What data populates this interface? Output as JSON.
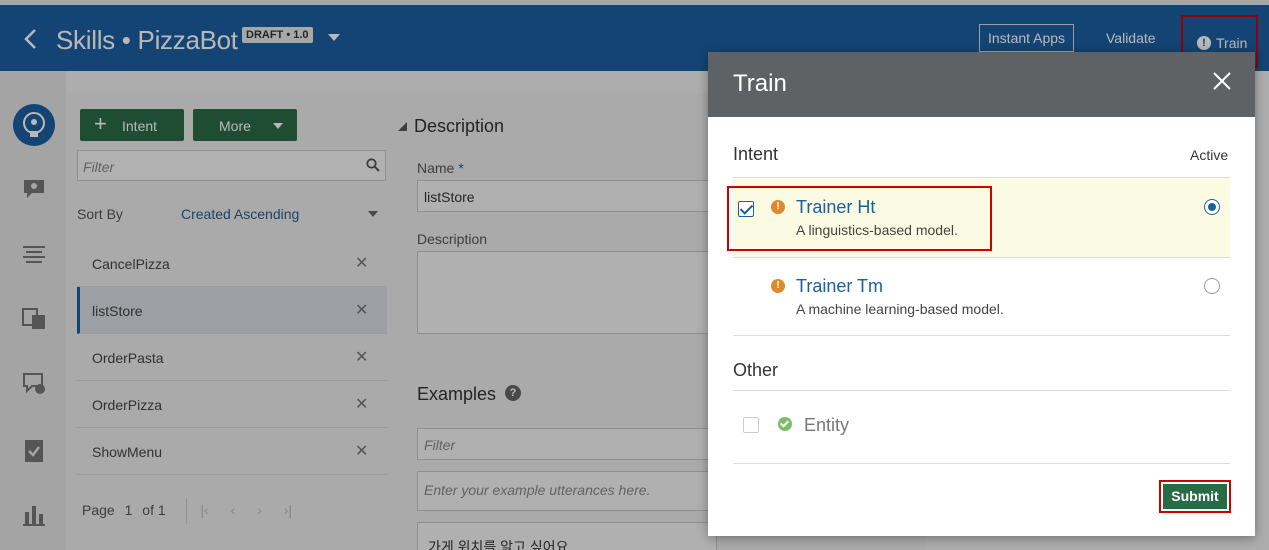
{
  "header": {
    "title": "Skills • PizzaBot",
    "badge": "DRAFT • 1.0",
    "instant_apps": "Instant Apps",
    "validate": "Validate",
    "train": "Train"
  },
  "left_panel": {
    "add_intent": "Intent",
    "more": "More",
    "filter_placeholder": "Filter",
    "sort_by_label": "Sort By",
    "sort_by_value": "Created Ascending",
    "intents": [
      {
        "name": "CancelPizza"
      },
      {
        "name": "listStore"
      },
      {
        "name": "OrderPasta"
      },
      {
        "name": "OrderPizza"
      },
      {
        "name": "ShowMenu"
      }
    ],
    "pager": {
      "label": "Page",
      "current": "1",
      "of": "of 1"
    }
  },
  "center": {
    "section": "Description",
    "name_label": "Name",
    "name_value": "listStore",
    "desc_label": "Description",
    "examples": "Examples",
    "filter_placeholder": "Filter",
    "utterance_placeholder": "Enter your example utterances here.",
    "example_1": "가게 위치를 알고 싶어요"
  },
  "dialog": {
    "title": "Train",
    "intent_section": "Intent",
    "active_label": "Active",
    "trainers": [
      {
        "name": "Trainer Ht",
        "desc": "A linguistics-based model.",
        "checked": true,
        "active": true
      },
      {
        "name": "Trainer Tm",
        "desc": "A machine learning-based model.",
        "checked": false,
        "active": false
      }
    ],
    "other_section": "Other",
    "entity_label": "Entity",
    "submit": "Submit"
  },
  "colors": {
    "header_blue": "#1c5fa0",
    "button_green": "#2a6b47",
    "highlight_red": "#cc0000",
    "warning_orange": "#e0892c",
    "success_green": "#7dbb67"
  }
}
